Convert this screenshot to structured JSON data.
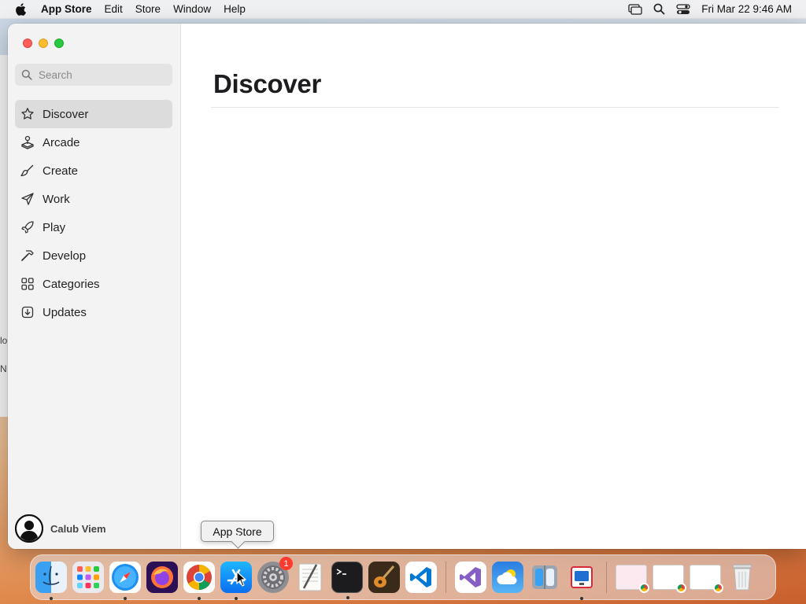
{
  "menubar": {
    "app_name": "App Store",
    "items": [
      "Edit",
      "Store",
      "Window",
      "Help"
    ],
    "clock": "Fri Mar 22  9:46 AM"
  },
  "window": {
    "search_placeholder": "Search",
    "nav": [
      {
        "label": "Discover",
        "icon": "star-icon",
        "active": true
      },
      {
        "label": "Arcade",
        "icon": "joystick-icon"
      },
      {
        "label": "Create",
        "icon": "brush-icon"
      },
      {
        "label": "Work",
        "icon": "paper-plane-icon"
      },
      {
        "label": "Play",
        "icon": "rocket-icon"
      },
      {
        "label": "Develop",
        "icon": "hammer-icon"
      },
      {
        "label": "Categories",
        "icon": "grid-icon"
      },
      {
        "label": "Updates",
        "icon": "download-icon"
      }
    ],
    "account_name": "Calub Viem",
    "page_title": "Discover"
  },
  "tooltip": "App Store",
  "dock": {
    "apps": [
      "Finder",
      "Launchpad",
      "Safari",
      "Firefox",
      "Chrome",
      "App Store",
      "System Settings",
      "TextEdit",
      "Terminal",
      "GarageBand",
      "Visual Studio Code",
      "Visual Studio",
      "Weather",
      "Migration Assistant",
      "Remote Desktop",
      "Trash"
    ],
    "settings_badge": "1"
  },
  "colors": {
    "accent": "#0a84ff",
    "close": "#ff5f57",
    "minimize": "#febc2e",
    "zoom": "#28c840"
  }
}
